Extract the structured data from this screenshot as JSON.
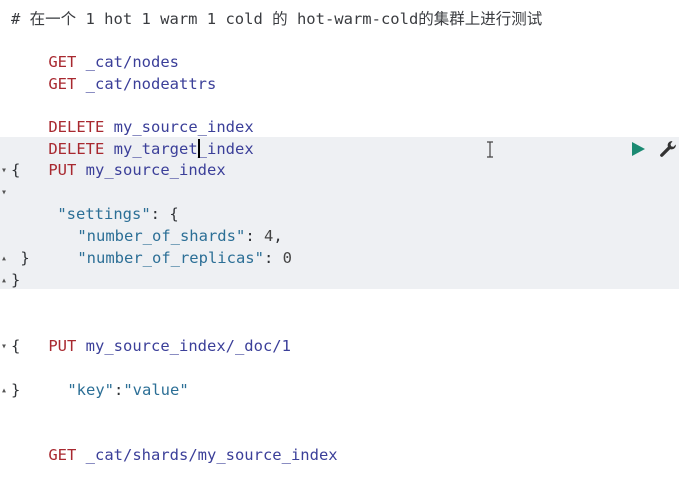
{
  "editor": {
    "lines": [
      {
        "text": "# 在一个 1 hot 1 warm 1 cold 的 hot-warm-cold的集群上进行测试"
      },
      {
        "method": "GET",
        "url": "_cat/nodes"
      },
      {
        "method": "GET",
        "url": "_cat/nodeattrs"
      },
      {
        "method": "DELETE",
        "url": "my_source_index"
      },
      {
        "method": "DELETE",
        "url": "my_target_index"
      },
      {
        "method": "PUT",
        "url": "my_source_index"
      },
      {
        "brace_open": "{"
      },
      {
        "key": "\"settings\"",
        "after": ": {"
      },
      {
        "key": "\"number_of_shards\"",
        "sep": ": ",
        "value": "4",
        "after": ","
      },
      {
        "key": "\"number_of_replicas\"",
        "sep": ": ",
        "value": "0"
      },
      {
        "close": " }"
      },
      {
        "close": "}"
      },
      {
        "method": "PUT",
        "url": "my_source_index/_doc/1"
      },
      {
        "brace_open": "{"
      },
      {
        "key": "\"key\"",
        "sep": ":",
        "value": "\"value\""
      },
      {
        "close": "}"
      },
      {
        "method": "GET",
        "url": "_cat/shards/my_source_index"
      }
    ]
  },
  "toolbar": {
    "run_icon": "play-icon",
    "settings_icon": "wrench-icon",
    "run_color": "#1b8a72",
    "wrench_color": "#333333"
  }
}
